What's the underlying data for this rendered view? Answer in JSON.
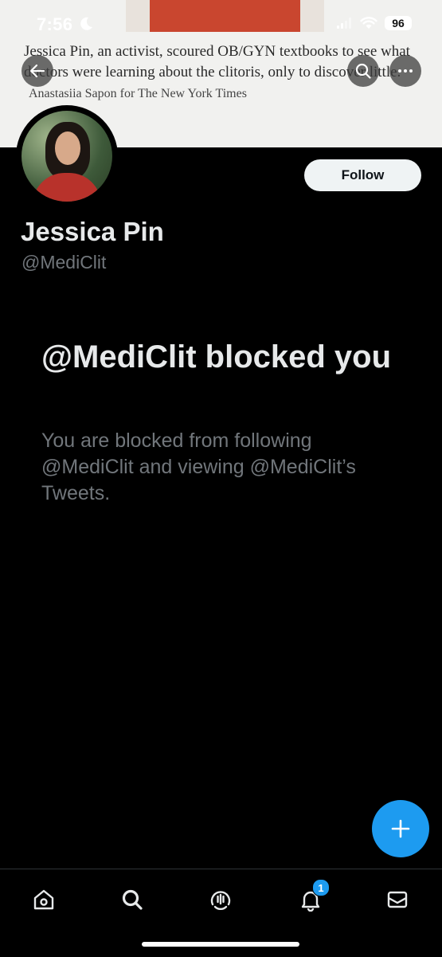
{
  "status_bar": {
    "time": "7:56",
    "battery": "96"
  },
  "banner": {
    "caption": "Jessica Pin, an activist, scoured OB/GYN textbooks to see what doctors were learning about the clitoris, only to discover little.",
    "credit": "Anastasiia Sapon for The New York Times"
  },
  "header_buttons": {
    "back_icon": "arrow-left-icon",
    "search_icon": "search-icon",
    "more_icon": "more-horizontal-icon"
  },
  "profile": {
    "name": "Jessica Pin",
    "handle": "@MediClit",
    "follow_label": "Follow"
  },
  "blocked": {
    "title": "@MediClit blocked you",
    "description": "You are blocked from following @MediClit and viewing @MediClit’s Tweets."
  },
  "fab": {
    "icon": "plus-icon"
  },
  "bottom_nav": {
    "items": [
      {
        "icon": "home-icon"
      },
      {
        "icon": "search-icon"
      },
      {
        "icon": "spaces-icon"
      },
      {
        "icon": "bell-icon",
        "badge": "1"
      },
      {
        "icon": "mail-icon"
      }
    ]
  },
  "colors": {
    "background": "#000000",
    "accent": "#1d9bf0",
    "primary_text": "#e7e9ea",
    "secondary_text": "#71767b"
  }
}
